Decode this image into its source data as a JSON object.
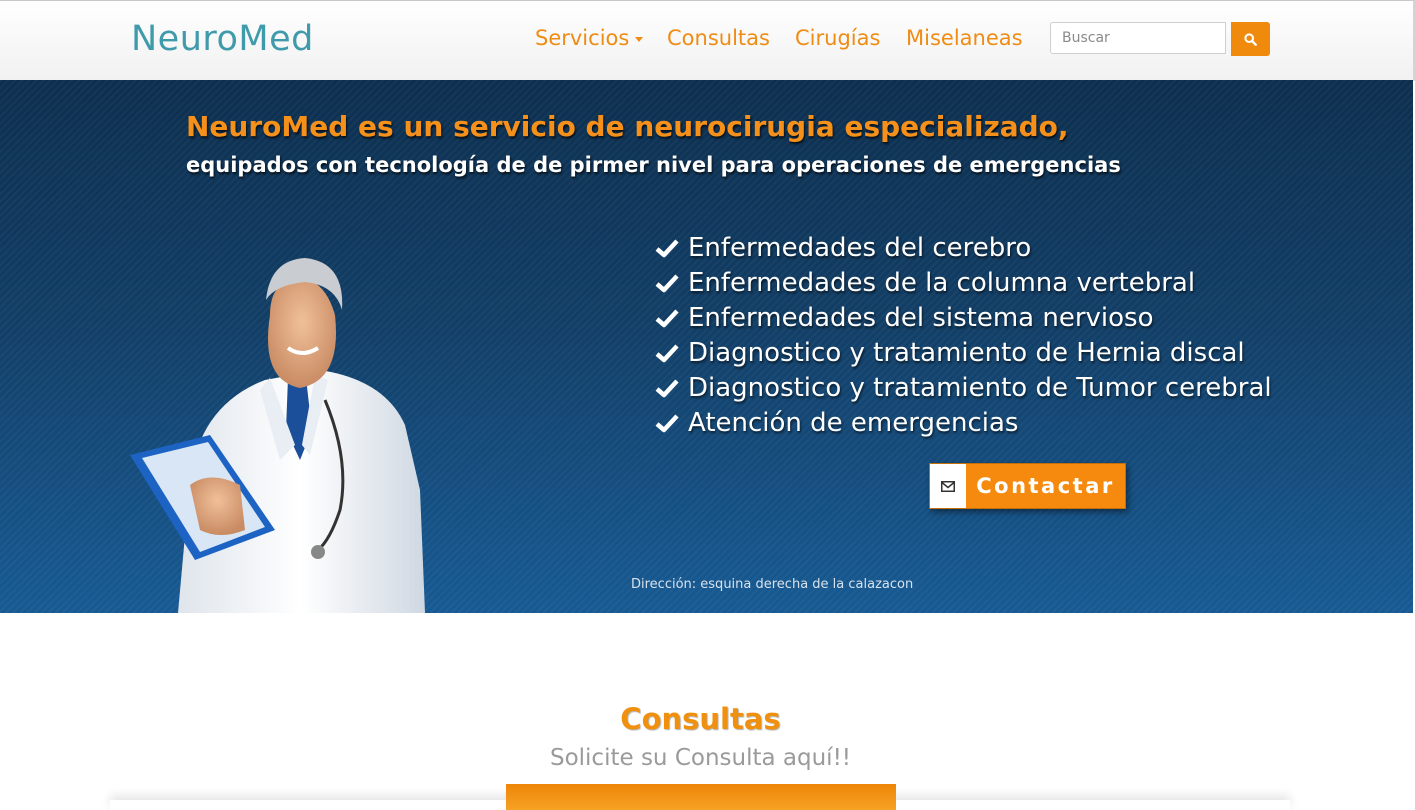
{
  "colors": {
    "brand": "#3f9bab",
    "accent": "#f08a0c",
    "hero_top": "#0d2f4f",
    "hero_bottom": "#175a93"
  },
  "navbar": {
    "brand": "NeuroMed",
    "links": [
      "Servicios",
      "Consultas",
      "Cirugías",
      "Miselaneas"
    ],
    "search": {
      "placeholder": "Buscar",
      "value": "",
      "icon": "search-icon"
    }
  },
  "hero": {
    "headline_highlight": "NeuroMed es un servicio de neurocirugia especializado,",
    "headline_rest": "equipados con tecnología de de pirmer nivel para operaciones de emergencias",
    "image": "doctor-with-clipboard",
    "features": [
      "Enfermedades del cerebro",
      "Enfermedades de la columna vertebral",
      "Enfermedades del sistema nervioso",
      "Diagnostico y tratamiento de Hernia discal",
      "Diagnostico y tratamiento de Tumor cerebral",
      "Atención de emergencias"
    ],
    "feature_icon": "check-icon",
    "contact_button": {
      "label": "Contactar",
      "icon": "envelope-icon"
    },
    "address": "Dirección: esquina derecha de la calazacon"
  },
  "consultas": {
    "title": "Consultas",
    "subtitle": "Solicite su Consulta aquí!!"
  }
}
